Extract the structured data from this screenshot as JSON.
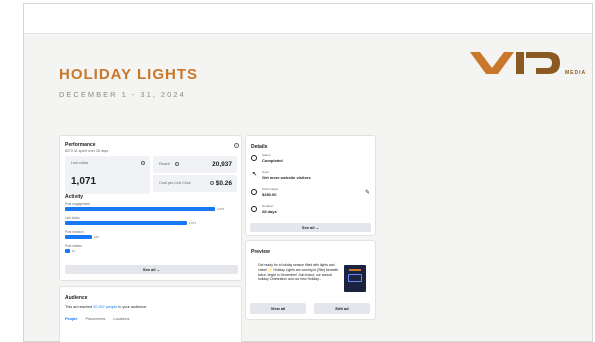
{
  "header": {
    "title": "HOLIDAY LIGHTS",
    "subtitle": "DECEMBER 1 - 31, 2024",
    "logo_text": "MEDIA",
    "brand_color": "#c9772a"
  },
  "performance": {
    "title": "Performance",
    "subtitle": "$270.31 spent over 28 days",
    "link_clicks_label": "Link clicks",
    "link_clicks_value": "1,071",
    "reach_label": "Reach",
    "reach_value": "20,937",
    "cost_label": "Cost per Link Click",
    "cost_value": "$0.26",
    "info_icon": "i"
  },
  "activity": {
    "title": "Activity",
    "accent_color": "#1877f2",
    "items": [
      {
        "label": "Post engagement",
        "value": "3,075",
        "fill": 0.88
      },
      {
        "label": "Link clicks",
        "value": "1,071",
        "fill": 0.72
      },
      {
        "label": "Post reaction",
        "value": "160",
        "fill": 0.16
      },
      {
        "label": "Post shares",
        "value": "10",
        "fill": 0.03
      }
    ],
    "see_all": "See all ⌄"
  },
  "audience": {
    "title": "Audience",
    "text_prefix": "This ad reached ",
    "text_link": "20,937 people",
    "text_suffix": " in your audience.",
    "tabs": [
      "People",
      "Placements",
      "Locations"
    ]
  },
  "details": {
    "title": "Details",
    "rows": [
      {
        "label": "Status",
        "value": "Completed",
        "icon": "status-icon"
      },
      {
        "label": "Goal",
        "value": "Get more website visitors",
        "icon": "cursor-icon"
      },
      {
        "label": "Total budget",
        "value": "$280.00",
        "icon": "budget-icon"
      },
      {
        "label": "Duration",
        "value": "28 days",
        "icon": "clock-icon"
      }
    ],
    "see_all": "See all ⌄"
  },
  "preview": {
    "title": "Preview",
    "text": "Get ready for a holiday season filled with lights and cheer! ✨ Holiday Lights are coming to [Site] beneath twice, bright in December! Join brand, our annual holiday Celebration and our new Holiday...",
    "view_all": "View all",
    "edit_ad": "Edit ad"
  }
}
